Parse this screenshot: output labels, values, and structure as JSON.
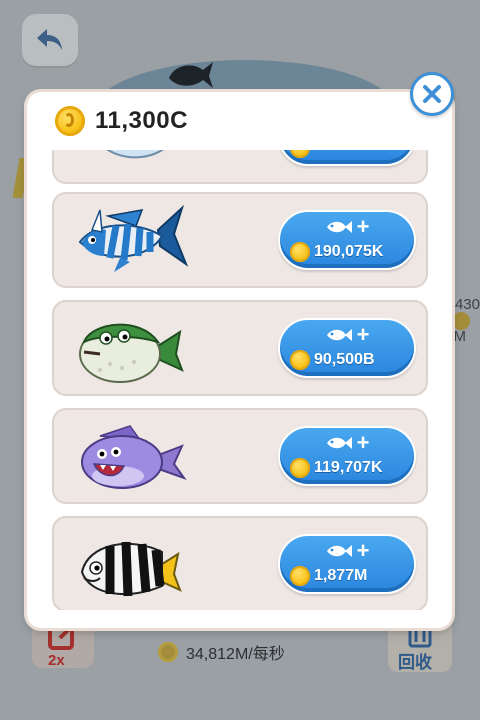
{
  "modal": {
    "balance": "11,300C",
    "items": [
      {
        "name": "blue-fish-partial",
        "price": ""
      },
      {
        "name": "striped-blue-fish",
        "price": "190,075K"
      },
      {
        "name": "green-puffer-fish",
        "price": "90,500B"
      },
      {
        "name": "purple-monster-fish",
        "price": "119,707K"
      },
      {
        "name": "black-white-angelfish",
        "price": "1,877M"
      }
    ]
  },
  "background": {
    "income": "34,812M/每秒",
    "speed_badge": "2x",
    "recycle_label": "回收",
    "side_number": "430",
    "side_unit": "M"
  },
  "colors": {
    "button_blue": "#2a86de",
    "coin_gold": "#f7c21a",
    "item_bg": "#efe7e4"
  }
}
